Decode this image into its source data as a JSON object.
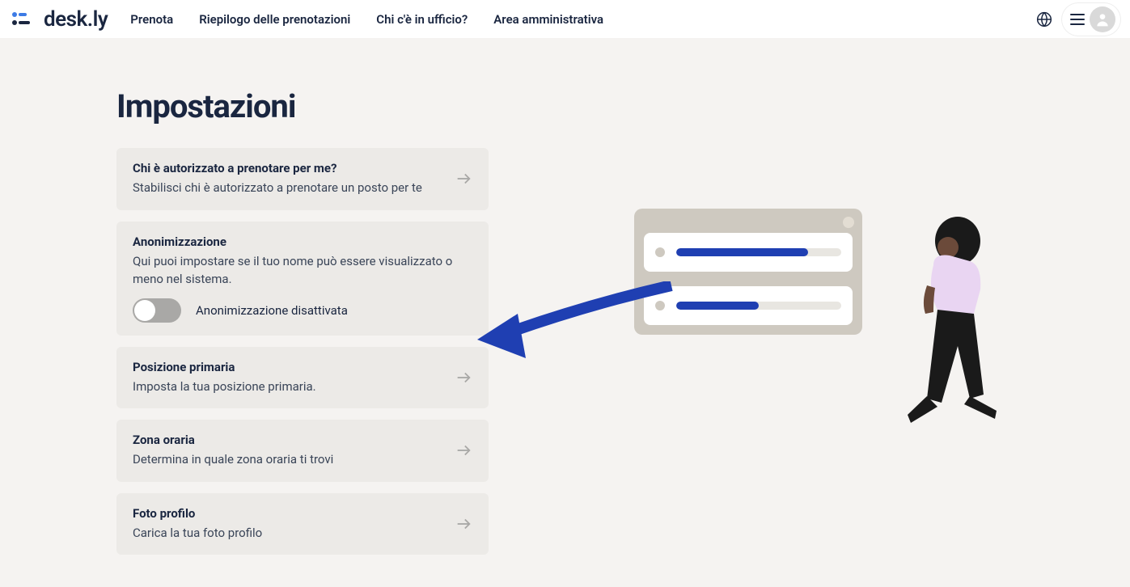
{
  "brand": {
    "name": "desk.ly"
  },
  "nav": {
    "book": "Prenota",
    "summary": "Riepilogo delle prenotazioni",
    "who": "Chi c'è in ufficio?",
    "admin": "Area amministrativa"
  },
  "page": {
    "title": "Impostazioni"
  },
  "cards": {
    "authorize": {
      "title": "Chi è autorizzato a prenotare per me?",
      "desc": "Stabilisci chi è autorizzato a prenotare un posto per te"
    },
    "anonymize": {
      "title": "Anonimizzazione",
      "desc": "Qui puoi impostare se il tuo nome può essere visualizzato o meno nel sistema.",
      "toggle_label": "Anonimizzazione disattivata",
      "toggle_state": "off"
    },
    "primary_position": {
      "title": "Posizione primaria",
      "desc": "Imposta la tua posizione primaria."
    },
    "timezone": {
      "title": "Zona oraria",
      "desc": "Determina in quale zona oraria ti trovi"
    },
    "profile_photo": {
      "title": "Foto profilo",
      "desc": "Carica la tua foto profilo"
    }
  },
  "colors": {
    "accent": "#1f3fb2",
    "background": "#f5f3f1",
    "card": "#eceae7",
    "text": "#1a2640"
  }
}
